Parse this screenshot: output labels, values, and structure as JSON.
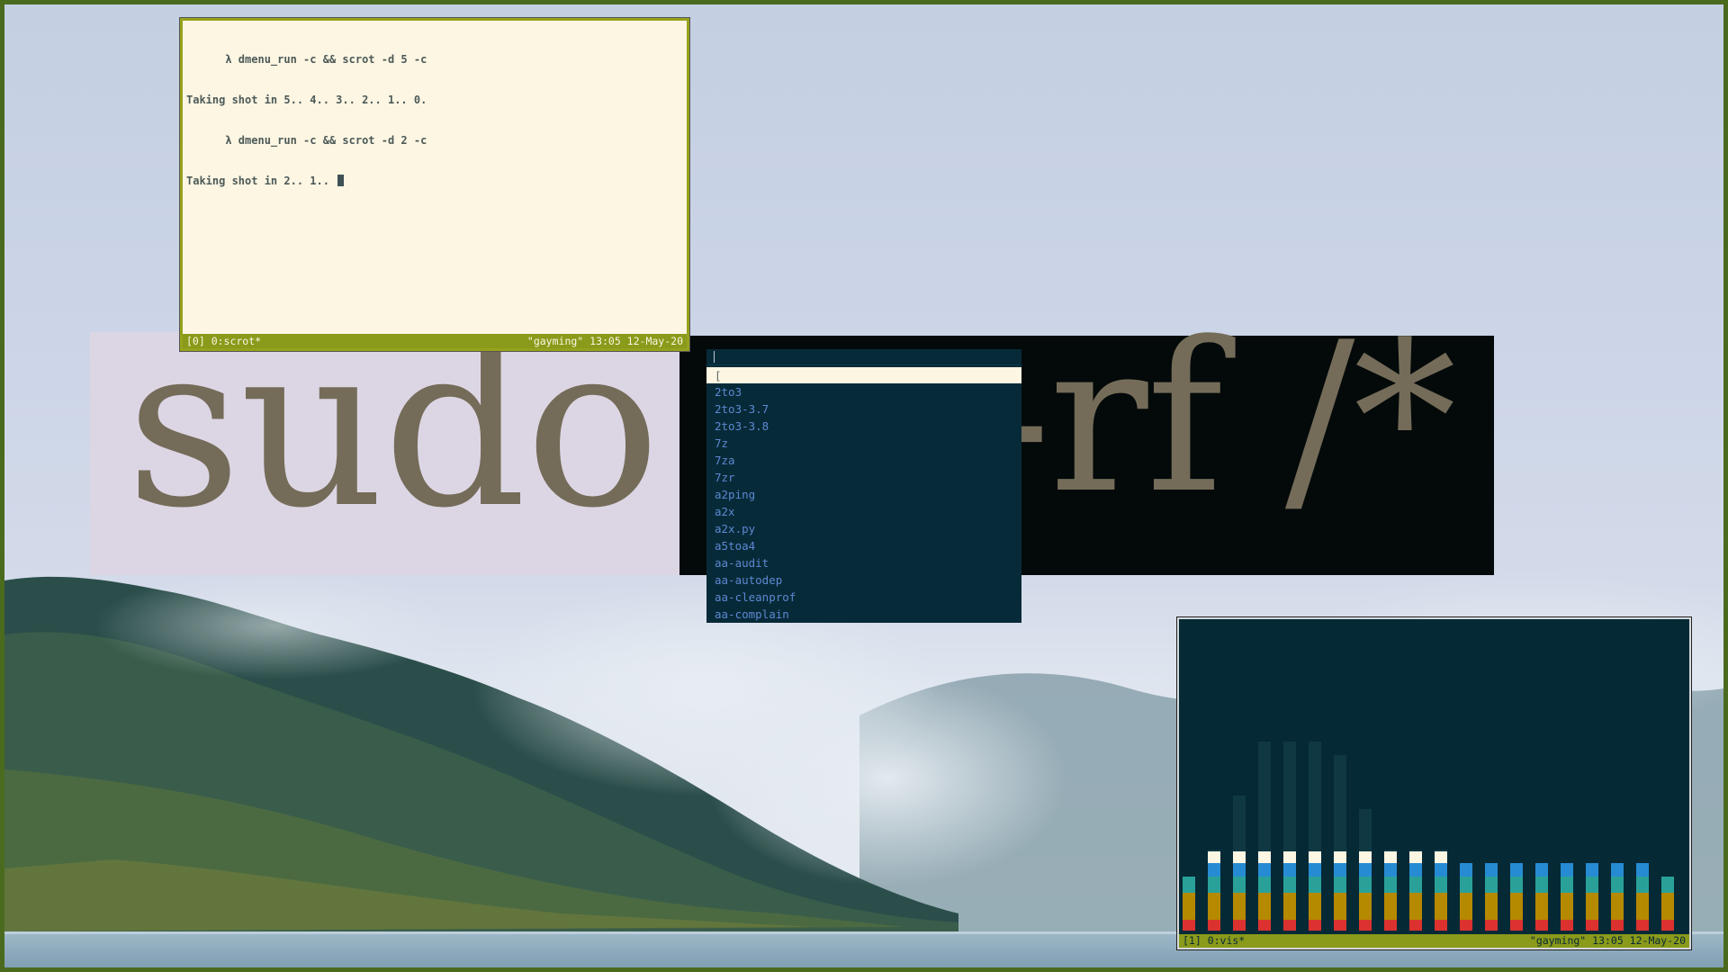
{
  "banner": {
    "word_sudo": "sudo",
    "word_rf": "-rf /*"
  },
  "terminal_top": {
    "lines": [
      "      λ dmenu_run -c && scrot -d 5 -c",
      "Taking shot in 5.. 4.. 3.. 2.. 1.. 0.",
      "      λ dmenu_run -c && scrot -d 2 -c",
      "Taking shot in 2.. 1.. "
    ],
    "status_left": "[0] 0:scrot*",
    "status_right": "\"gayming\" 13:05 12-May-20"
  },
  "dmenu": {
    "input": "",
    "items": [
      "[",
      "2to3",
      "2to3-3.7",
      "2to3-3.8",
      "7z",
      "7za",
      "7zr",
      "a2ping",
      "a2x",
      "a2x.py",
      "a5toa4",
      "aa-audit",
      "aa-autodep",
      "aa-cleanprof",
      "aa-complain"
    ],
    "selected_index": 0
  },
  "visualizer": {
    "status_left": "[1] 0:vis*",
    "status_right": "\"gayming\" 13:05 12-May-20",
    "bar_levels": [
      0.12,
      0.3,
      0.5,
      0.7,
      0.7,
      0.7,
      0.65,
      0.45,
      0.3,
      0.3,
      0.3,
      0.25,
      0.2,
      0.17,
      0.17,
      0.17,
      0.17,
      0.17,
      0.17,
      0.12
    ],
    "colors": {
      "red": "#dc322f",
      "yellow": "#b58900",
      "cyan": "#2aa198",
      "blue": "#268bd2",
      "cream": "#fdf6e3"
    }
  },
  "colors": {
    "frame": "#4a6a1e",
    "accent": "#8a9a1a",
    "terminal_bg": "#fdf6e3",
    "dmenu_bg": "#072a38"
  }
}
